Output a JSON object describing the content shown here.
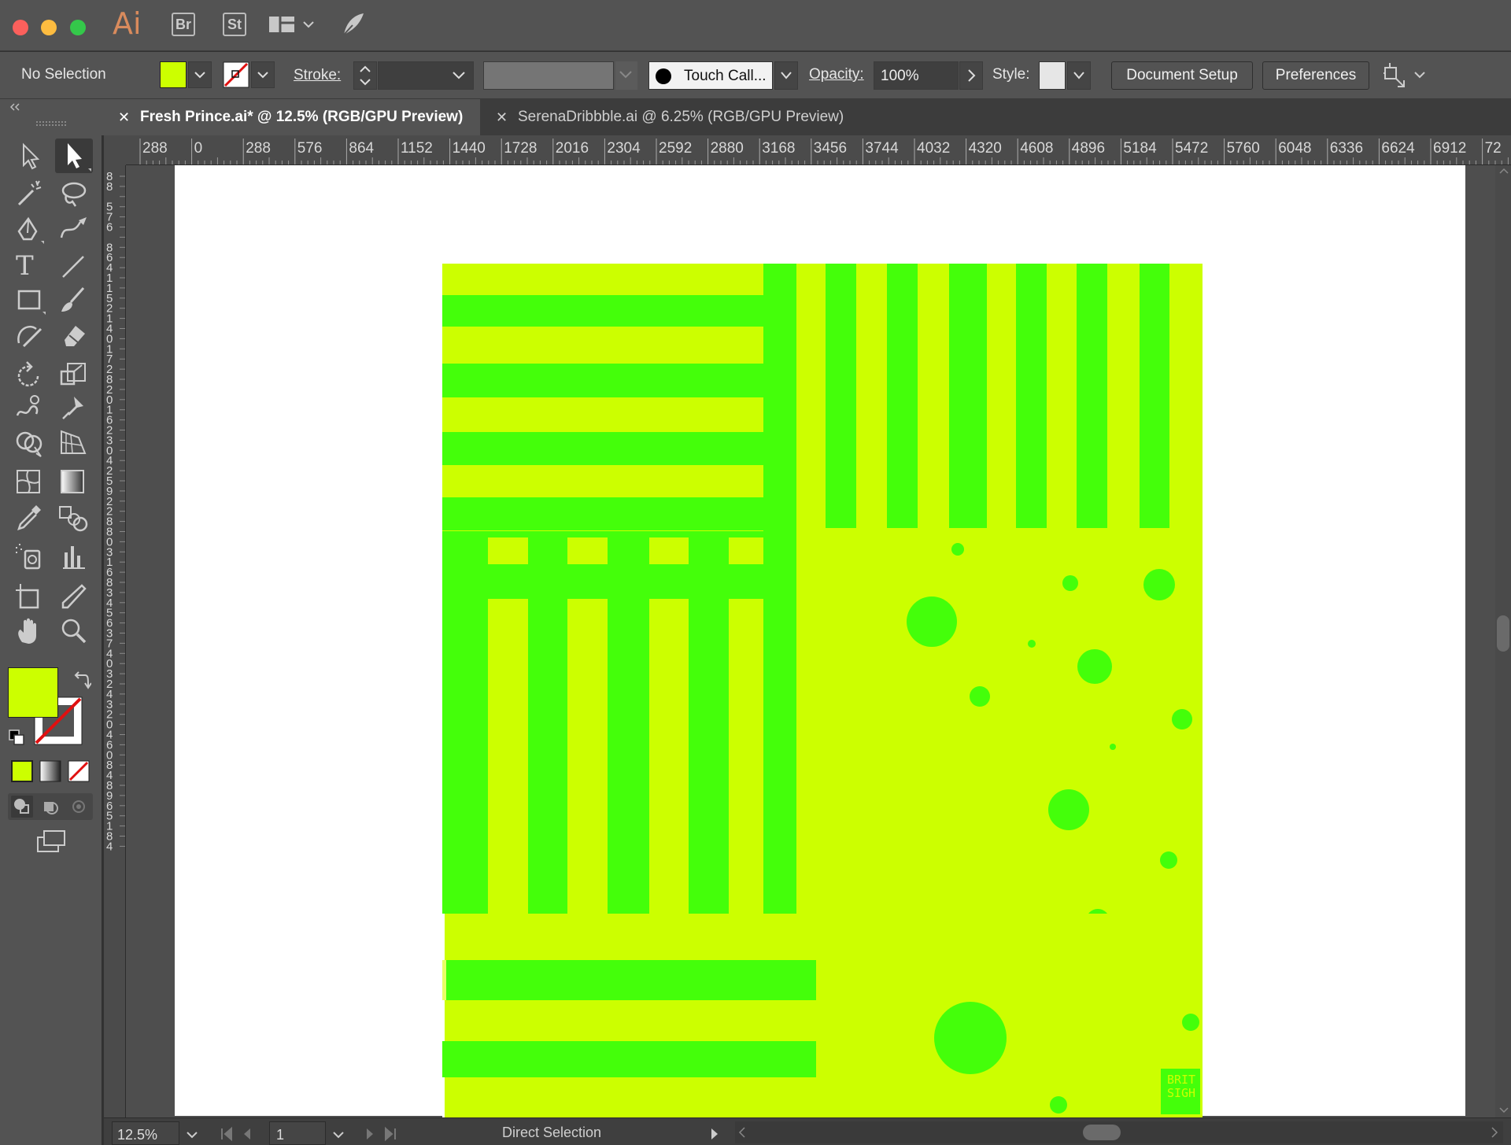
{
  "app": {
    "logo": "Ai",
    "bridge_label": "Br",
    "stock_label": "St",
    "traffic_lights": [
      "#fc605c",
      "#fdbc40",
      "#34c84a"
    ]
  },
  "control_bar": {
    "selection_label": "No Selection",
    "fill_color": "#ccff00",
    "stroke_label": "Stroke:",
    "brush_name": "Touch Call...",
    "opacity_label": "Opacity:",
    "opacity_value": "100%",
    "style_label": "Style:",
    "document_setup_label": "Document Setup",
    "preferences_label": "Preferences"
  },
  "tabs": [
    {
      "label": "Fresh Prince.ai* @ 12.5% (RGB/GPU Preview)",
      "active": true
    },
    {
      "label": "SerenaDribbble.ai @ 6.25% (RGB/GPU Preview)",
      "active": false
    }
  ],
  "ruler": {
    "horizontal_labels": [
      "288",
      "0",
      "288",
      "576",
      "864",
      "1152",
      "1440",
      "1728",
      "2016",
      "2304",
      "2592",
      "2880",
      "3168",
      "3456",
      "3744",
      "4032",
      "4320",
      "4608",
      "4896",
      "5184",
      "5472",
      "5760",
      "6048",
      "6336",
      "6624",
      "6912",
      "72"
    ],
    "vertical_digits": [
      "8",
      "8",
      "",
      "5",
      "7",
      "6",
      "",
      "8",
      "6",
      "4",
      "1",
      "1",
      "5",
      "2",
      "1",
      "4",
      "0",
      "1",
      "7",
      "2",
      "8",
      "2",
      "0",
      "1",
      "6",
      "2",
      "3",
      "0",
      "4",
      "2",
      "5",
      "9",
      "2",
      "2",
      "8",
      "8",
      "0",
      "3",
      "1",
      "6",
      "8",
      "3",
      "4",
      "5",
      "6",
      "3",
      "7",
      "4",
      "0",
      "3",
      "2",
      "4",
      "3",
      "2",
      "0",
      "4",
      "6",
      "0",
      "8",
      "4",
      "8",
      "9",
      "6",
      "5",
      "1",
      "8",
      "4"
    ]
  },
  "artwork": {
    "background": "#ccff00",
    "accent": "#44ff0a",
    "signature": "BRIT SIGH"
  },
  "status_bar": {
    "zoom": "12.5%",
    "artboard": "1",
    "tool_name": "Direct Selection"
  },
  "toolbar_colors": {
    "fill": "#ccff00"
  }
}
